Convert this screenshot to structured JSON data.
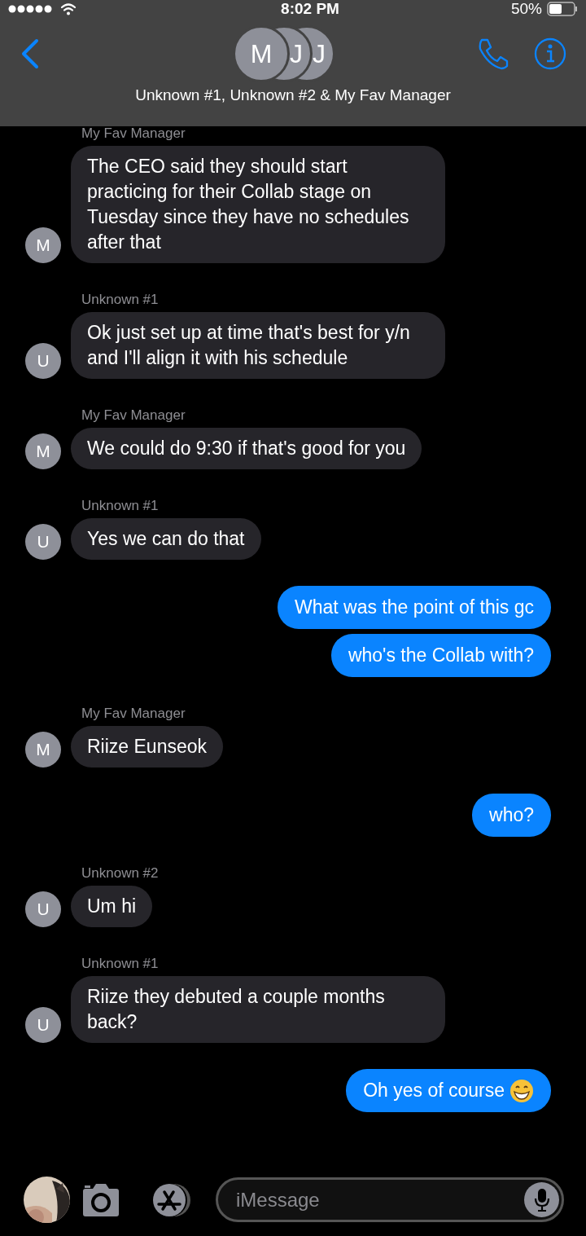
{
  "status_bar": {
    "time": "8:02 PM",
    "battery": "50%"
  },
  "header": {
    "avatars": [
      "M",
      "J",
      "J"
    ],
    "title": "Unknown #1, Unknown #2 & My Fav Manager"
  },
  "messages": [
    {
      "kind": "received",
      "sender": "My Fav Manager",
      "avatar": "M",
      "text": "The CEO said they should start practicing for their Collab stage on Tuesday since they have no schedules after that"
    },
    {
      "kind": "received",
      "sender": "Unknown #1",
      "avatar": "U",
      "text": "Ok just set up at time that's best for y/n and I'll align it with his schedule"
    },
    {
      "kind": "received",
      "sender": "My Fav Manager",
      "avatar": "M",
      "text": "We could do 9:30 if that's good for you"
    },
    {
      "kind": "received",
      "sender": "Unknown #1",
      "avatar": "U",
      "text": "Yes we can do that"
    },
    {
      "kind": "sent",
      "text": "What was the point of this gc"
    },
    {
      "kind": "sent",
      "text": "who's the Collab with?"
    },
    {
      "kind": "received",
      "sender": "My Fav Manager",
      "avatar": "M",
      "text": "Riize Eunseok"
    },
    {
      "kind": "sent",
      "text": "who?"
    },
    {
      "kind": "received",
      "sender": "Unknown #2",
      "avatar": "U",
      "text": "Um hi"
    },
    {
      "kind": "received",
      "sender": "Unknown #1",
      "avatar": "U",
      "text": "Riize they debuted a couple months back?"
    },
    {
      "kind": "sent",
      "text": "Oh yes of course",
      "emoji": true
    }
  ],
  "composer": {
    "placeholder": "iMessage"
  }
}
